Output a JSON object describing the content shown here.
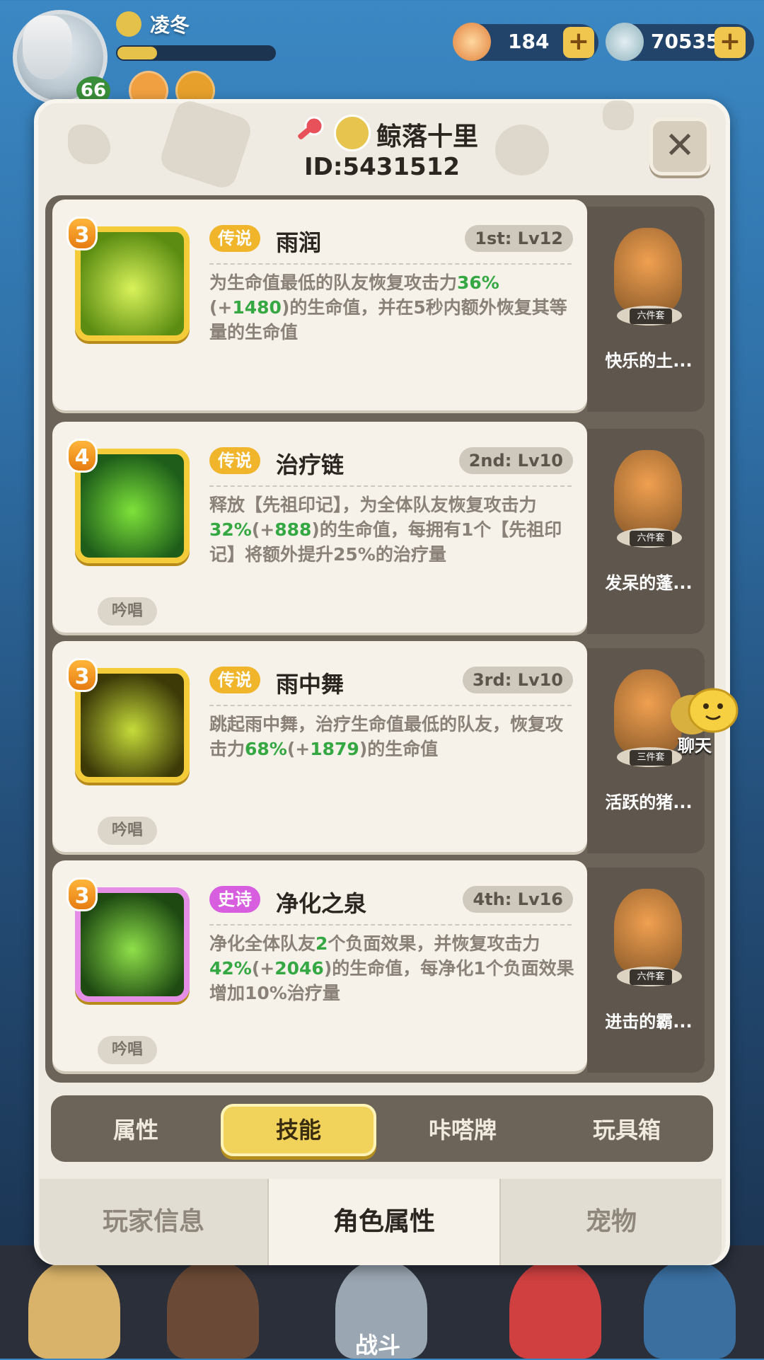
{
  "player": {
    "name": "凌冬",
    "level": "66",
    "xp_fraction": 0.25
  },
  "currencies": [
    {
      "name": "gem",
      "value": "184"
    },
    {
      "name": "shell",
      "value": "70535"
    }
  ],
  "profile": {
    "title_name": "鲸落十里",
    "id_text": "ID:5431512"
  },
  "skills": [
    {
      "level": "3",
      "rarity": "传说",
      "rarity_color": "#f0b52a",
      "name": "雨润",
      "rank": "1st: Lv12",
      "desc": [
        "为生命值最低的队友恢复攻击力",
        "36%",
        "(+",
        "1480",
        ")的生命值，并在5秒内额外恢复其等量的生命值"
      ],
      "chant": "",
      "pet_set": "六件套",
      "pet_name": "快乐的土...",
      "icon_colors": [
        "#5c8d12",
        "#d9f25a"
      ],
      "frame": "#f4cc3a"
    },
    {
      "level": "4",
      "rarity": "传说",
      "rarity_color": "#f0b52a",
      "name": "治疗链",
      "rank": "2nd: Lv10",
      "desc": [
        "释放【先祖印记】，为全体队友恢复攻击力",
        "32%",
        "(+",
        "888",
        ")的生命值，每拥有1个【先祖印记】将额外提升25%的治疗量"
      ],
      "chant": "吟唱",
      "pet_set": "六件套",
      "pet_name": "发呆的蓬...",
      "icon_colors": [
        "#1e5e1a",
        "#7ee23a"
      ],
      "frame": "#f4cc3a"
    },
    {
      "level": "3",
      "rarity": "传说",
      "rarity_color": "#f0b52a",
      "name": "雨中舞",
      "rank": "3rd: Lv10",
      "desc": [
        "跳起雨中舞，治疗生命值最低的队友，恢复攻击力",
        "68%",
        "(+",
        "1879",
        ")的生命值"
      ],
      "chant": "吟唱",
      "pet_set": "三件套",
      "pet_name": "活跃的猪...",
      "icon_colors": [
        "#3d3a08",
        "#c6dc3a"
      ],
      "frame": "#f4cc3a"
    },
    {
      "level": "3",
      "rarity": "史诗",
      "rarity_color": "#d85ee0",
      "name": "净化之泉",
      "rank": "4th: Lv16",
      "desc": [
        "净化全体队友",
        "2",
        "个负面效果，并恢复攻击力",
        "42%",
        "(+",
        "2046",
        ")的生命值，每净化1个负面效果增加10%治疗量"
      ],
      "chant": "吟唱",
      "pet_set": "六件套",
      "pet_name": "进击的霸...",
      "icon_colors": [
        "#1e4a12",
        "#8fe04a"
      ],
      "frame": "#e58ee6"
    }
  ],
  "tabs": [
    "属性",
    "技能",
    "咔嗒牌",
    "玩具箱"
  ],
  "active_tab": "技能",
  "bottom_tabs": [
    "玩家信息",
    "角色属性",
    "宠物"
  ],
  "active_bottom_tab": "角色属性",
  "chat_label": "聊天",
  "nav_battle_label": "战斗"
}
